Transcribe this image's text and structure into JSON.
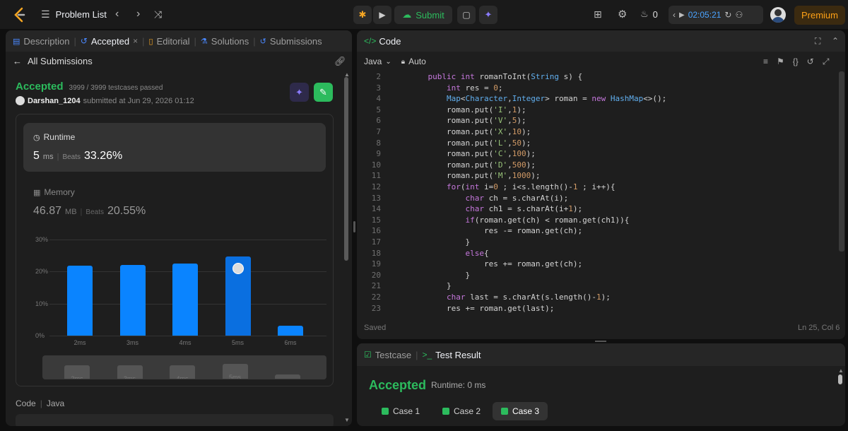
{
  "topbar": {
    "problem_list": "Problem List",
    "submit": "Submit",
    "streak": "0",
    "timer": "02:05:21",
    "premium": "Premium"
  },
  "left": {
    "tabs": [
      "Description",
      "Accepted",
      "Editorial",
      "Solutions",
      "Submissions"
    ],
    "back": "All Submissions",
    "status": "Accepted",
    "testcases": "3999 / 3999 testcases passed",
    "user": "Darshan_1204",
    "submitted": "submitted at Jun 29, 2026 01:12",
    "runtime_label": "Runtime",
    "runtime_value": "5",
    "runtime_unit": "ms",
    "beats_label": "Beats",
    "runtime_beats": "33.26%",
    "memory_label": "Memory",
    "memory_value": "46.87",
    "memory_unit": "MB",
    "memory_beats": "20.55%",
    "code_label": "Code",
    "lang": "Java"
  },
  "chart_data": {
    "type": "bar",
    "categories": [
      "2ms",
      "3ms",
      "4ms",
      "5ms",
      "6ms"
    ],
    "values": [
      21.8,
      22.1,
      22.5,
      24.8,
      3.0
    ],
    "highlight": "5ms",
    "yticks": [
      "30%",
      "20%",
      "10%",
      "0%"
    ],
    "ylim": [
      0,
      30
    ]
  },
  "editor": {
    "title": "Code",
    "lang": "Java",
    "mode": "Auto",
    "saved": "Saved",
    "cursor": "Ln 25, Col 6",
    "lines": [
      {
        "n": "2",
        "t": "    public int romanToInt(String s) {"
      },
      {
        "n": "3",
        "t": "        int res = 0;"
      },
      {
        "n": "4",
        "t": "        Map<Character,Integer> roman = new HashMap<>();"
      },
      {
        "n": "5",
        "t": "        roman.put('I',1);"
      },
      {
        "n": "6",
        "t": "        roman.put('V',5);"
      },
      {
        "n": "7",
        "t": "        roman.put('X',10);"
      },
      {
        "n": "8",
        "t": "        roman.put('L',50);"
      },
      {
        "n": "9",
        "t": "        roman.put('C',100);"
      },
      {
        "n": "10",
        "t": "        roman.put('D',500);"
      },
      {
        "n": "11",
        "t": "        roman.put('M',1000);"
      },
      {
        "n": "12",
        "t": "        for(int i=0 ; i<s.length()-1 ; i++){"
      },
      {
        "n": "13",
        "t": "            char ch = s.charAt(i);"
      },
      {
        "n": "14",
        "t": "            char ch1 = s.charAt(i+1);"
      },
      {
        "n": "15",
        "t": "            if(roman.get(ch) < roman.get(ch1)){"
      },
      {
        "n": "16",
        "t": "                res -= roman.get(ch);"
      },
      {
        "n": "17",
        "t": "            }"
      },
      {
        "n": "18",
        "t": "            else{"
      },
      {
        "n": "19",
        "t": "                res += roman.get(ch);"
      },
      {
        "n": "20",
        "t": "            }"
      },
      {
        "n": "21",
        "t": "        }"
      },
      {
        "n": "22",
        "t": "        char last = s.charAt(s.length()-1);"
      },
      {
        "n": "23",
        "t": "        res += roman.get(last);"
      }
    ]
  },
  "bottom": {
    "tab_testcase": "Testcase",
    "tab_result": "Test Result",
    "status": "Accepted",
    "runtime": "Runtime: 0 ms",
    "cases": [
      "Case 1",
      "Case 2",
      "Case 3"
    ]
  }
}
